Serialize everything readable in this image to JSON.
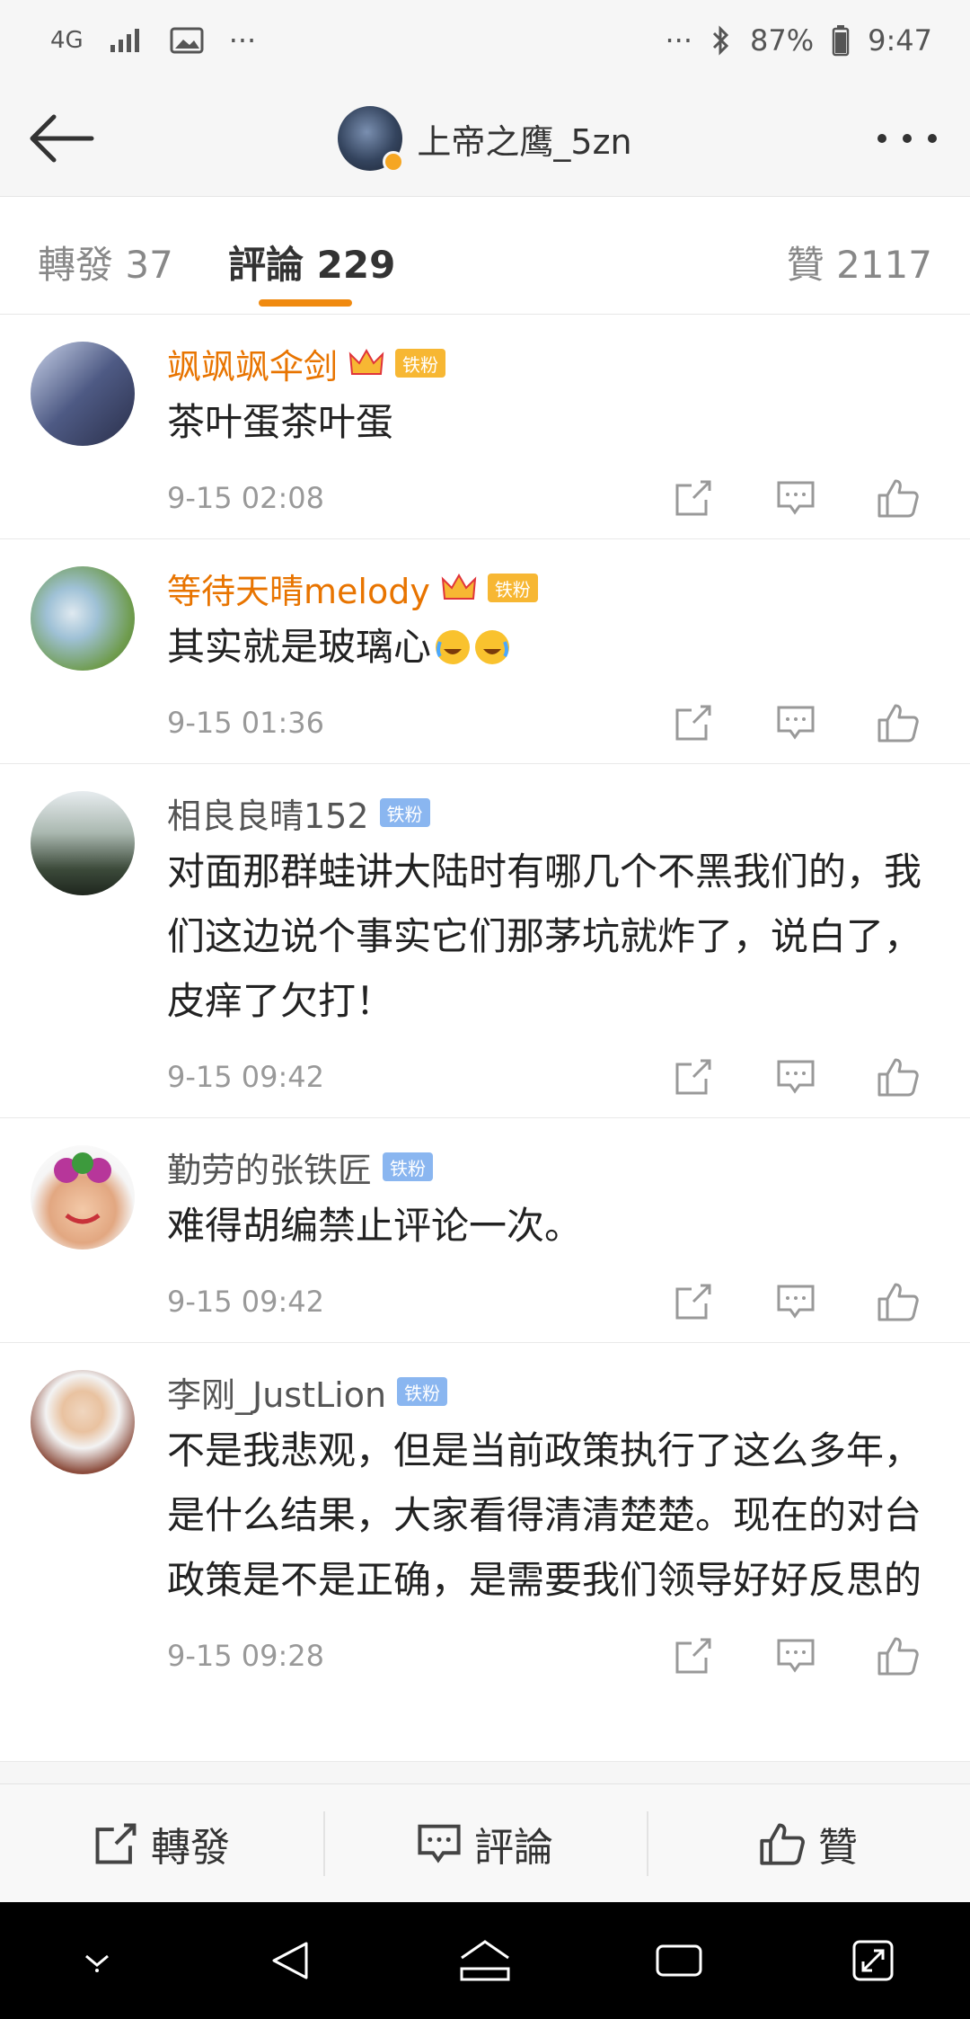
{
  "status_bar": {
    "network": "4G",
    "ellipsis_left": "···",
    "ellipsis_right": "···",
    "battery": "87%",
    "time": "9:47"
  },
  "header": {
    "title": "上帝之鹰_5zn"
  },
  "tabs": [
    {
      "label": "轉發 37"
    },
    {
      "label": "評論 229"
    },
    {
      "label": "贊 2117"
    }
  ],
  "comments": [
    {
      "username": "飒飒飒伞剑",
      "badge": "铁粉",
      "text": "茶叶蛋茶叶蛋",
      "time": "9-15 02:08"
    },
    {
      "username": "等待天晴melody",
      "badge": "铁粉",
      "text": "其实就是玻璃心",
      "time": "9-15 01:36"
    },
    {
      "username": "相良良晴152",
      "badge": "铁粉",
      "text": "对面那群蛙讲大陆时有哪几个不黑我们的，我们这边说个事实它们那茅坑就炸了，说白了，皮痒了欠打！",
      "time": "9-15 09:42"
    },
    {
      "username": "勤劳的张铁匠",
      "badge": "铁粉",
      "text": "难得胡编禁止评论一次。",
      "time": "9-15 09:42"
    },
    {
      "username": "李刚_JustLion",
      "badge": "铁粉",
      "text": "不是我悲观，但是当前政策执行了这么多年，是什么结果，大家看得清清楚楚。现在的对台政策是不是正确，是需要我们领导好好反思的",
      "time": "9-15 09:28"
    }
  ],
  "bottom_bar": {
    "repost": "轉發",
    "comment": "評論",
    "like": "贊"
  },
  "colors": {
    "accent": "#f08a10",
    "gold_name": "#e87400",
    "background": "#f6f6f6"
  }
}
